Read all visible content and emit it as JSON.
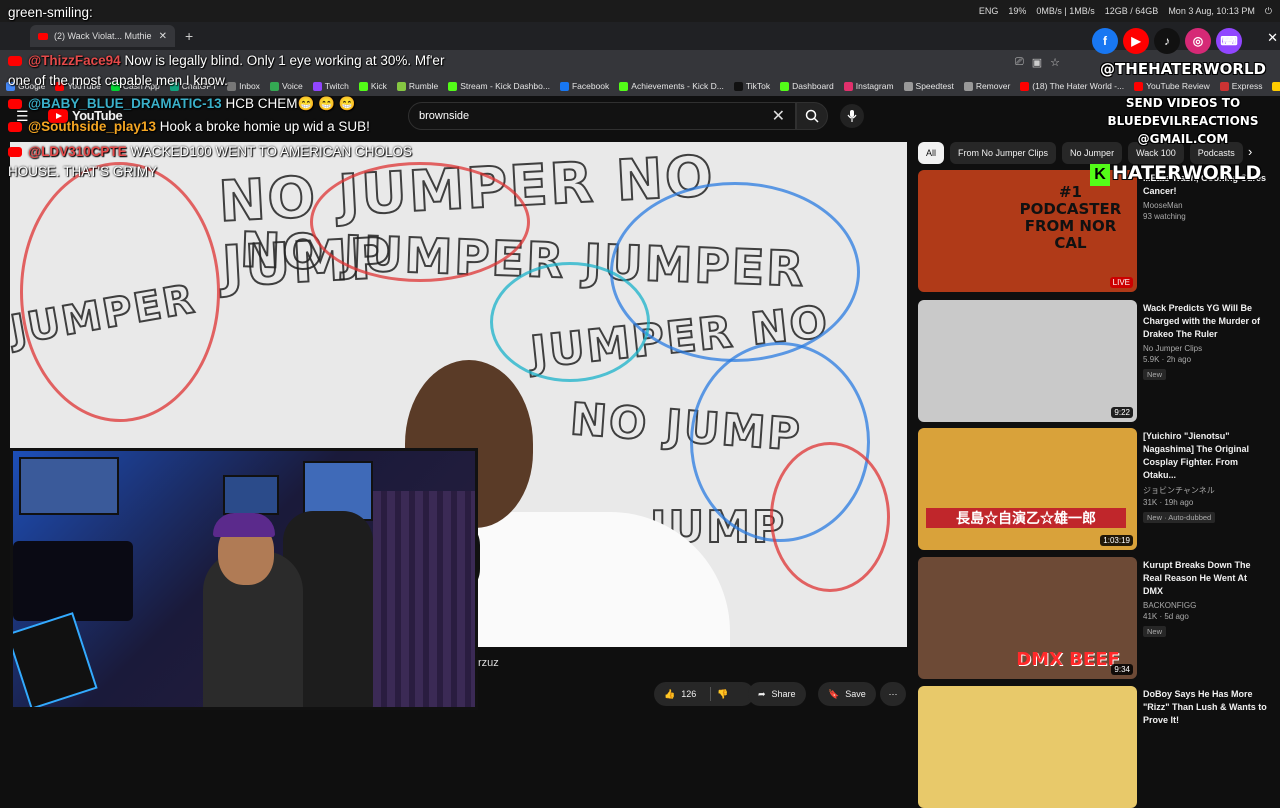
{
  "system": {
    "lang": "ENG",
    "battery": "19%",
    "network": "0MB/s | 1MB/s",
    "memory": "12GB / 64GB",
    "datetime": "Mon 3 Aug, 10:13 PM"
  },
  "browser": {
    "tab_title": "(2) Wack Violat... Muthie",
    "new_tab": "+",
    "bookmarks": [
      {
        "label": "Google",
        "color": "#4285f4"
      },
      {
        "label": "YouTube",
        "color": "#ff0000"
      },
      {
        "label": "Cash App",
        "color": "#00d632"
      },
      {
        "label": "ChatGPT",
        "color": "#10a37f"
      },
      {
        "label": "Inbox",
        "color": "#777"
      },
      {
        "label": "Voice",
        "color": "#34a853"
      },
      {
        "label": "Twitch",
        "color": "#9146ff"
      },
      {
        "label": "Kick",
        "color": "#53fc18"
      },
      {
        "label": "Rumble",
        "color": "#85c742"
      },
      {
        "label": "Stream - Kick Dashbo...",
        "color": "#53fc18"
      },
      {
        "label": "Facebook",
        "color": "#1877f2"
      },
      {
        "label": "Achievements - Kick D...",
        "color": "#53fc18"
      },
      {
        "label": "TikTok",
        "color": "#111"
      },
      {
        "label": "Dashboard",
        "color": "#53fc18"
      },
      {
        "label": "Instagram",
        "color": "#e1306c"
      },
      {
        "label": "Speedtest",
        "color": "#999"
      },
      {
        "label": "Remover",
        "color": "#999"
      },
      {
        "label": "(18) The Hater World -...",
        "color": "#ff0000"
      },
      {
        "label": "YouTube Review",
        "color": "#ff0000"
      },
      {
        "label": "Express",
        "color": "#c33"
      },
      {
        "label": "GetEmoji",
        "color": "#fc0"
      }
    ]
  },
  "youtube": {
    "logo": "YouTube",
    "search_value": "brownside",
    "clear_icon": "✕"
  },
  "video": {
    "title_fragment": "rzuz",
    "likes": "126",
    "share_label": "Share",
    "save_label": "Save"
  },
  "chat": [
    {
      "user": "",
      "text": "green-smiling:"
    },
    {
      "user": "@ThizzFace94",
      "text": "Now is legally blind. Only 1 eye working at 30%. Mf'er"
    },
    {
      "user": "",
      "text": "one of the most capable men I know."
    },
    {
      "user": "@BABY_BLUE_DRAMATIC-13",
      "text": "HCB CHEM😁 😁 😁"
    },
    {
      "user": "@Southside_play13",
      "text": "Hook a broke homie up wid a SUB!"
    },
    {
      "user": "@LDV310CPTE",
      "text": "WACKED100 WENT TO AMERICAN CHOLOS"
    },
    {
      "user": "",
      "text": "HOUSE. THAT'S GRIMY"
    }
  ],
  "chips": [
    "All",
    "From No Jumper Clips",
    "No Jumper",
    "Wack 100",
    "Podcasts"
  ],
  "recommendations": [
    {
      "title": "...Eats Trash, Gooning Cures Cancer!",
      "channel": "MooseMan",
      "meta": "93 watching",
      "badge": "",
      "duration": "LIVE",
      "thumb_text": "#1 PODCASTER FROM NOR CAL",
      "bg": "#b03a18"
    },
    {
      "title": "Wack Predicts YG Will Be Charged with the Murder of Drakeo The Ruler",
      "channel": "No Jumper Clips",
      "meta": "5.9K · 2h ago",
      "badge": "New",
      "duration": "9:22",
      "thumb_text": "",
      "bg": "#c9c9c9"
    },
    {
      "title": "[Yuichiro \"Jienotsu\" Nagashima] The Original Cosplay Fighter. From Otaku...",
      "channel": "ジョビンチャンネル",
      "meta": "31K · 19h ago",
      "badge": "New · Auto-dubbed",
      "duration": "1:03:19",
      "thumb_text": "長島☆自演乙☆雄一郎",
      "bg": "#d9a23a"
    },
    {
      "title": "Kurupt Breaks Down The Real Reason He Went At DMX",
      "channel": "BACKONFIGG",
      "meta": "41K · 5d ago",
      "badge": "New",
      "duration": "9:34",
      "thumb_text": "DMX BEEF",
      "bg": "#6d4a36"
    },
    {
      "title": "DoBoy Says He Has More \"Rizz\" Than Lush & Wants to Prove It!",
      "channel": "",
      "meta": "",
      "badge": "",
      "duration": "",
      "thumb_text": "",
      "bg": "#e8c96a"
    }
  ],
  "brand": {
    "handle": "@THEHATERWORLD",
    "line1": "SEND VIDEOS TO",
    "line2": "BLUEDEVILREACTIONS",
    "line3": "@GMAIL.COM",
    "kick_name": "HATERWORLD",
    "socials": [
      {
        "icon": "facebook-icon",
        "glyph": "f",
        "color": "#1877f2"
      },
      {
        "icon": "youtube-icon",
        "glyph": "▶",
        "color": "#ff0000"
      },
      {
        "icon": "tiktok-icon",
        "glyph": "♪",
        "color": "#111"
      },
      {
        "icon": "instagram-icon",
        "glyph": "◎",
        "color": "#d62976"
      },
      {
        "icon": "twitch-icon",
        "glyph": "⌨",
        "color": "#9146ff"
      }
    ]
  }
}
